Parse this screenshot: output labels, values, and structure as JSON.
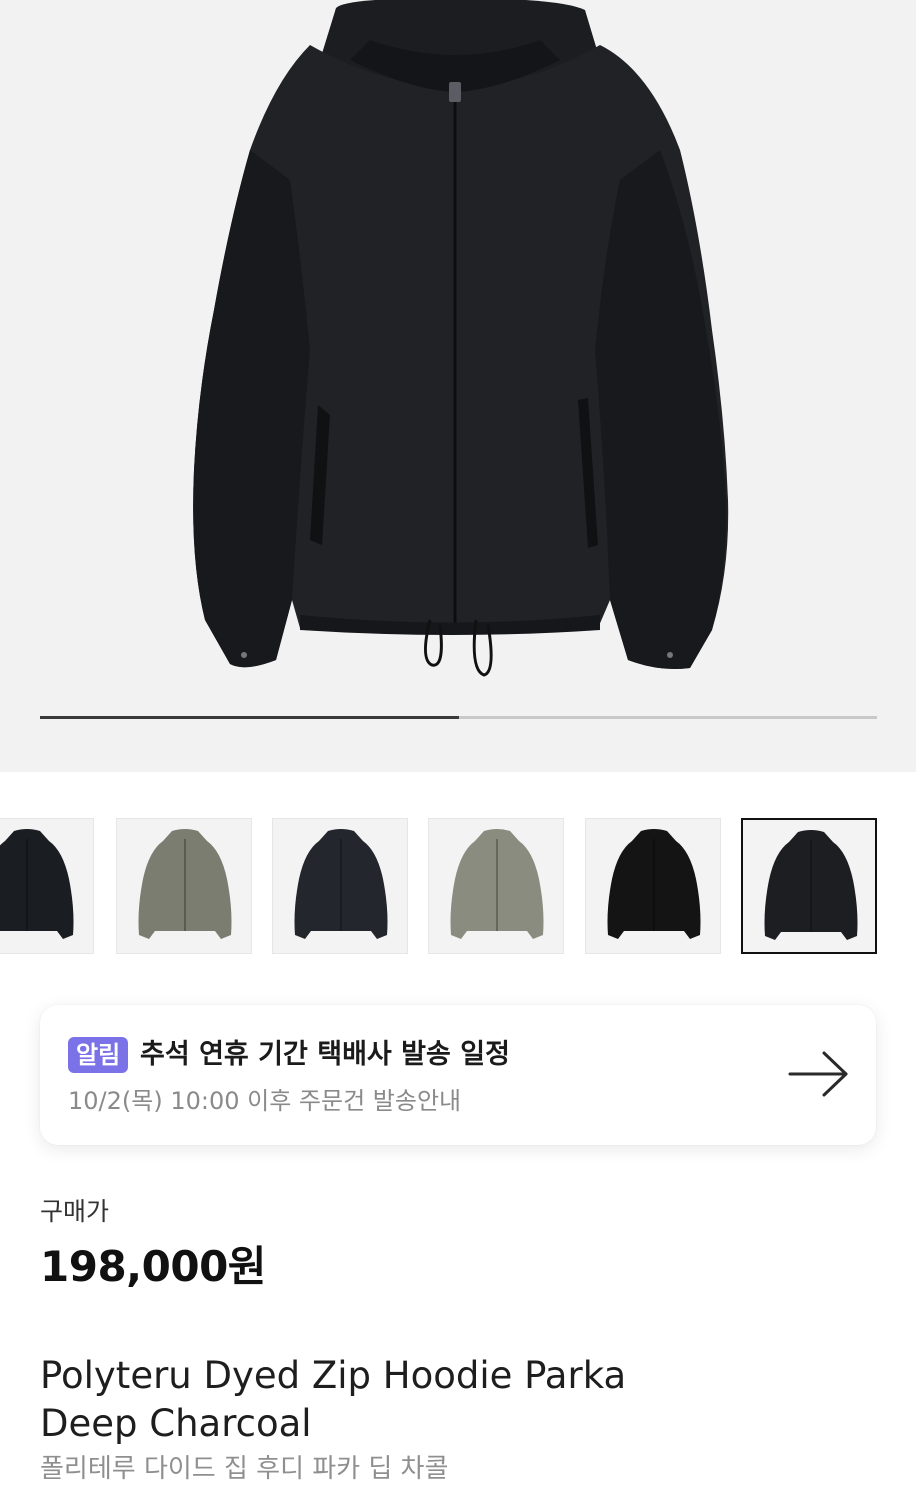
{
  "gallery": {
    "main_image": "black zip hoodie parka",
    "image_progress_percent": 50,
    "thumbnails": [
      {
        "name": "thumbnail-1",
        "color": "#1a1d22",
        "selected": false
      },
      {
        "name": "thumbnail-2",
        "color": "#7a7d6f",
        "selected": false
      },
      {
        "name": "thumbnail-3",
        "color": "#23262c",
        "selected": false
      },
      {
        "name": "thumbnail-4",
        "color": "#8b8c80",
        "selected": false
      },
      {
        "name": "thumbnail-5",
        "color": "#141414",
        "selected": false
      },
      {
        "name": "thumbnail-6",
        "color": "#1c1e22",
        "selected": true
      }
    ]
  },
  "notice": {
    "badge": "알림",
    "title": "추석 연휴 기간 택배사 발송 일정",
    "subtitle": "10/2(목) 10:00 이후 주문건 발송안내",
    "arrow_icon": "arrow-right-icon",
    "badge_color": "#7b72e8"
  },
  "product": {
    "price_label": "구매가",
    "price": "198,000원",
    "name_en_line1": "Polyteru Dyed Zip Hoodie Parka",
    "name_en_line2": "Deep Charcoal",
    "name_ko": "폴리테루 다이드 집 후디 파카 딥 차콜"
  }
}
